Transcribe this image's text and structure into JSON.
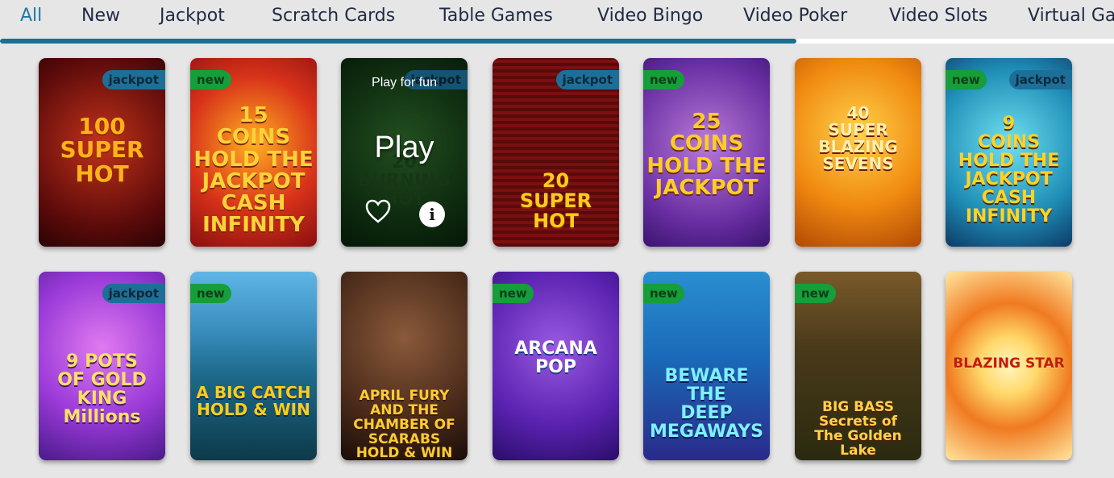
{
  "tabs": [
    {
      "label": "All",
      "active": true
    },
    {
      "label": "New"
    },
    {
      "label": "Jackpot"
    },
    {
      "label": "Scratch Cards"
    },
    {
      "label": "Table Games"
    },
    {
      "label": "Video Bingo"
    },
    {
      "label": "Video Poker"
    },
    {
      "label": "Video Slots"
    },
    {
      "label": "Virtual Ga"
    }
  ],
  "scroll_progress": 0.715,
  "hover_overlay": {
    "play_for_fun": "Play for fun",
    "play": "Play",
    "favorite_icon": "heart-icon",
    "info_icon": "info-icon",
    "info_glyph": "i"
  },
  "games": [
    {
      "title": "100\nSUPER\nHOT",
      "badge": "jackpot"
    },
    {
      "title": "15\nCOINS\nHOLD THE JACKPOT\nCASH INFINITY",
      "badge": "new"
    },
    {
      "title": "20\nBURNING\nHOT",
      "badge": "jackpot"
    },
    {
      "title": "20\nSUPER HOT",
      "badge": "jackpot"
    },
    {
      "title": "25\nCOINS\nHOLD THE JACKPOT",
      "badge": "new"
    },
    {
      "title": "40\nSUPER BLAZING\nSEVENS",
      "badge": ""
    },
    {
      "title": "9\nCOINS\nHOLD THE JACKPOT\nCASH INFINITY",
      "badge": "new jackpot"
    },
    {
      "title": "9 POTS\nOF GOLD\nKING Millions",
      "badge": "jackpot"
    },
    {
      "title": "A BIG CATCH\nHOLD & WIN",
      "badge": "new"
    },
    {
      "title": "APRIL FURY\nAND THE CHAMBER OF SCARABS\nHOLD & WIN",
      "badge": ""
    },
    {
      "title": "ARCANA\nPOP",
      "badge": "new"
    },
    {
      "title": "BEWARE\nTHE\nDEEP\nMEGAWAYS",
      "badge": "new"
    },
    {
      "title": "BIG BASS\nSecrets of\nThe Golden Lake",
      "badge": "new"
    },
    {
      "title": "BLAZING STAR",
      "badge": ""
    }
  ],
  "badge_labels": {
    "jackpot": "jackpot",
    "new": "new"
  },
  "colors": {
    "accent": "#1a6f93",
    "new_badge": "#159e3a",
    "jackpot_badge": "#1d6f98"
  }
}
